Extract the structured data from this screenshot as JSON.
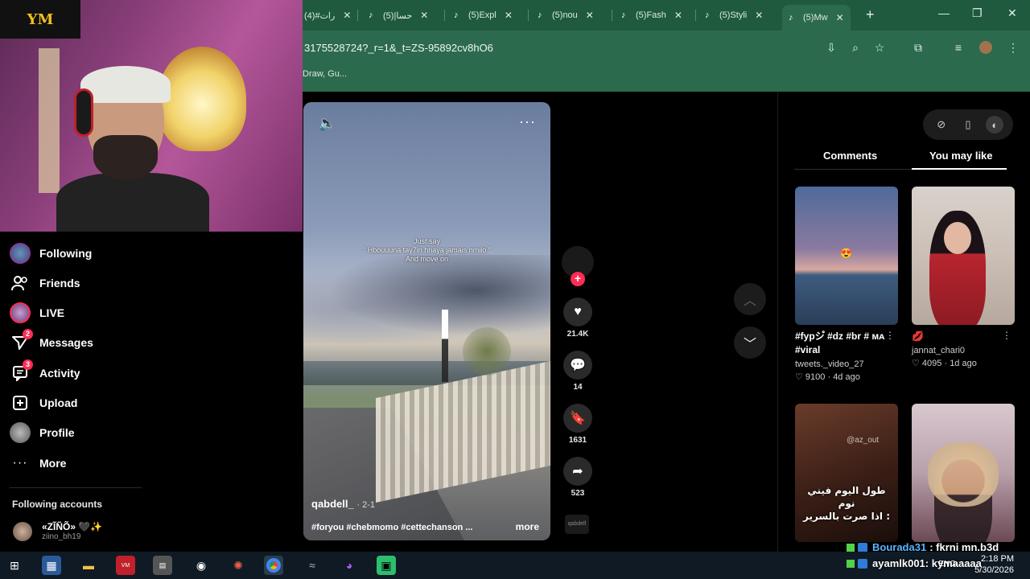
{
  "webcam": {
    "logo_text": "YM"
  },
  "browser": {
    "tabs": [
      {
        "label": "رات#(4)",
        "icon": "tiktok-icon"
      },
      {
        "label": "حسا|(5)",
        "icon": "tiktok-icon"
      },
      {
        "label": "(5)Expl",
        "icon": "tiktok-icon"
      },
      {
        "label": "(5)nou",
        "icon": "tiktok-icon"
      },
      {
        "label": "(5)Fash",
        "icon": "tiktok-icon"
      },
      {
        "label": "(5)Styli",
        "icon": "tiktok-icon"
      },
      {
        "label": "(5)Mw",
        "icon": "tiktok-icon",
        "active": true
      }
    ],
    "url": "3175528724?_r=1&_t=ZS-95892cv8hO6",
    "bookmark_text": "Draw, Gu..."
  },
  "sidebar": {
    "items": [
      {
        "label": "Following",
        "icon": "following-avatar-icon"
      },
      {
        "label": "Friends",
        "icon": "friends-icon"
      },
      {
        "label": "LIVE",
        "icon": "live-icon"
      },
      {
        "label": "Messages",
        "icon": "messages-icon",
        "badge": "2"
      },
      {
        "label": "Activity",
        "icon": "activity-icon",
        "badge": "3"
      },
      {
        "label": "Upload",
        "icon": "upload-icon"
      },
      {
        "label": "Profile",
        "icon": "profile-icon"
      },
      {
        "label": "More",
        "icon": "more-icon"
      }
    ],
    "following_title": "Following accounts",
    "account": {
      "name": "«ZĨÑÕ» 🖤✨",
      "handle": "ziino_bh19"
    }
  },
  "video": {
    "overlay_text": [
      "Just say",
      "\" Hbouuuna tay7in hnaya jamais nmilo \"",
      "And move on"
    ],
    "author": "qabdell_",
    "date": "· 2-1",
    "tags": "#foryou #chebmomo #cettechanson ...",
    "more_label": "more",
    "actions": {
      "likes": "21.4K",
      "comments": "14",
      "saves": "1631",
      "shares": "523"
    },
    "music_label": "qabdell"
  },
  "right_panel": {
    "tabs": [
      "Comments",
      "You may like"
    ],
    "active_tab": "You may like",
    "cards": [
      {
        "desc": "#fypシ゚ #dz #br # ᴍᴀ #viral",
        "user": "tweets._video_27",
        "likes": "9100",
        "age": "4d ago",
        "emoji": "😍"
      },
      {
        "desc": "💋",
        "user": "jannat_chari0",
        "likes": "4095",
        "age": "1d ago"
      },
      {
        "desc": "",
        "user": "",
        "likes": "",
        "age": "",
        "overlay": "طول اليوم فيني نوم\nاذا صرت بالسرير :",
        "watermark": "@az_out"
      },
      {
        "desc": "",
        "user": "",
        "likes": "",
        "age": ""
      }
    ]
  },
  "chat": [
    {
      "user": "Bourada31",
      "message": ": fkrni mn.b3d"
    },
    {
      "user": "ayamlk001",
      "message": ": kymaaaaa"
    }
  ],
  "taskbar": {
    "lang": "ENG",
    "time": "2:18 PM",
    "date": "5/30/2026"
  },
  "colors": {
    "accent": "#fe2c55",
    "chrome_green": "#2c6a4d",
    "chat_user": "#5ab4ff"
  }
}
